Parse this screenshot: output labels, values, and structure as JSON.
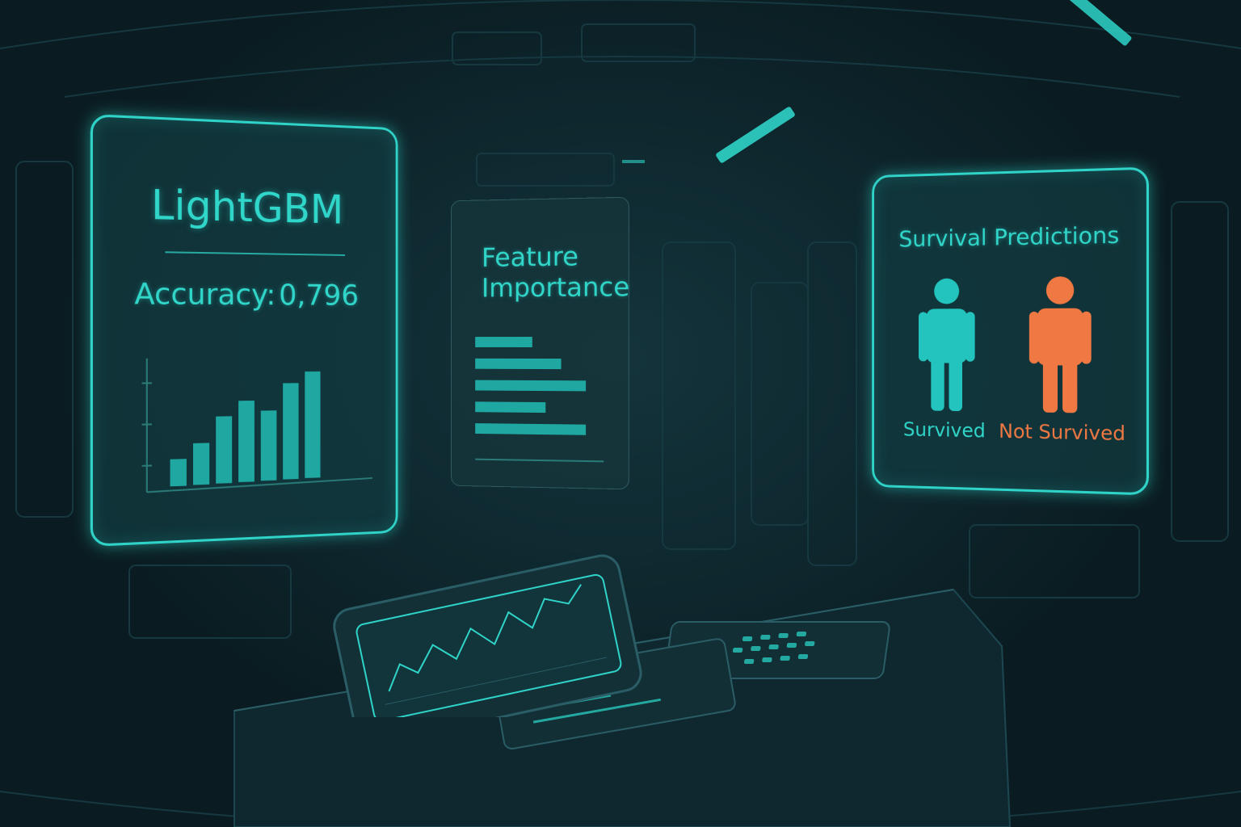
{
  "colors": {
    "accent": "#2fd3c8",
    "survived": "#22c4bd",
    "not_survived": "#ef7843",
    "background": "#0b1e24"
  },
  "model_panel": {
    "title": "LightGBM",
    "metric_label": "Accuracy:",
    "metric_value": "0,796",
    "chart_bars": [
      0.22,
      0.34,
      0.55,
      0.67,
      0.58,
      0.8,
      0.89
    ]
  },
  "feature_panel": {
    "title_line1": "Feature",
    "title_line2": "Importance",
    "bars": [
      0.52,
      0.78,
      1.0,
      0.64,
      1.0
    ]
  },
  "prediction_panel": {
    "title": "Survival Predictions",
    "survived_label": "Survived",
    "not_survived_label": "Not Survived",
    "survived_icon": "person-icon",
    "not_survived_icon": "person-icon"
  }
}
